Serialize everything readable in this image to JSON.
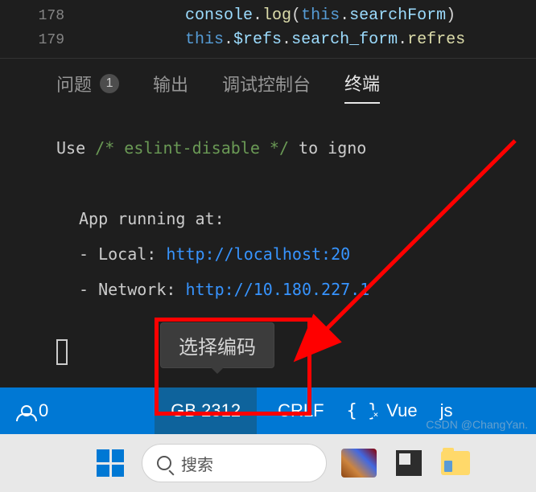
{
  "editor": {
    "lines": [
      {
        "num": "178",
        "tokens": [
          {
            "cls": "tk-obj",
            "t": "console"
          },
          {
            "cls": "tk-punct",
            "t": "."
          },
          {
            "cls": "tk-method",
            "t": "log"
          },
          {
            "cls": "tk-punct",
            "t": "("
          },
          {
            "cls": "tk-this",
            "t": "this"
          },
          {
            "cls": "tk-punct",
            "t": "."
          },
          {
            "cls": "tk-prop",
            "t": "searchForm"
          },
          {
            "cls": "tk-punct",
            "t": ")"
          }
        ]
      },
      {
        "num": "179",
        "tokens": [
          {
            "cls": "tk-this",
            "t": "this"
          },
          {
            "cls": "tk-punct",
            "t": "."
          },
          {
            "cls": "tk-prop",
            "t": "$refs"
          },
          {
            "cls": "tk-punct",
            "t": "."
          },
          {
            "cls": "tk-prop",
            "t": "search_form"
          },
          {
            "cls": "tk-punct",
            "t": "."
          },
          {
            "cls": "tk-method",
            "t": "refres"
          }
        ]
      }
    ]
  },
  "panel": {
    "tabs": {
      "problems": "问题",
      "problems_count": "1",
      "output": "输出",
      "debug": "调试控制台",
      "terminal": "终端"
    }
  },
  "terminal": {
    "line1_a": "Use ",
    "line1_comment": "/* eslint-disable */",
    "line1_b": " to igno",
    "running": "App running at:",
    "local_label": "- Local:   ",
    "local_url": "http://localhost:20",
    "network_label": "- Network: ",
    "network_url": "http://10.180.227.1"
  },
  "tooltip": "选择编码",
  "statusbar": {
    "ports": "0",
    "encoding": "GB 2312",
    "eol": "CRLF",
    "lang": "Vue",
    "js": "js"
  },
  "taskbar": {
    "search_placeholder": "搜索"
  },
  "watermark": "CSDN @ChangYan."
}
